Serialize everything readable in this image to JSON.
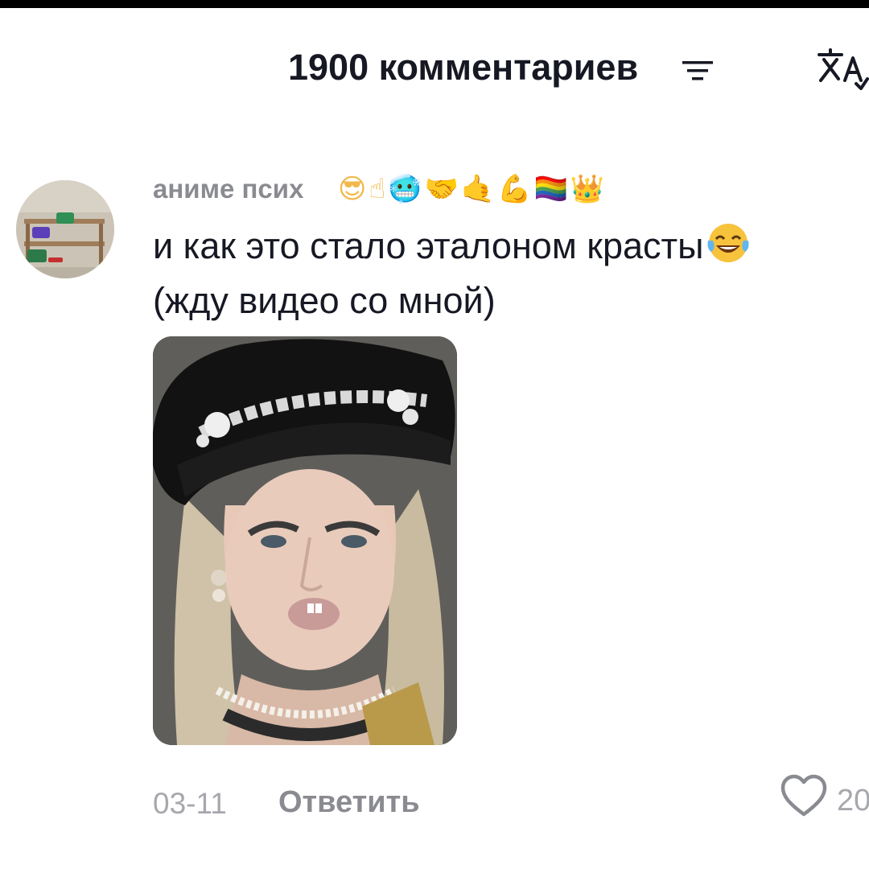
{
  "header": {
    "title": "1900 комментариев",
    "sort_icon": "sort-lines-icon",
    "translate_icon": "translate-icon"
  },
  "comment": {
    "username": "аниме псих",
    "username_emojis": [
      "😎",
      "☝",
      "🥶",
      "🤝",
      "🤙",
      "💪",
      "🏳️‍🌈",
      "👑"
    ],
    "text_line1": "и как это стало эталоном красты",
    "text_emoji": "😂",
    "text_line2": "(жду видео со мной)",
    "date": "03-11",
    "reply_label": "Ответить",
    "like_icon": "heart-outline-icon",
    "like_count": "20"
  },
  "colors": {
    "title": "#161823",
    "username": "#8a8b91",
    "meta": "#a7a8ad",
    "background": "#ffffff"
  }
}
